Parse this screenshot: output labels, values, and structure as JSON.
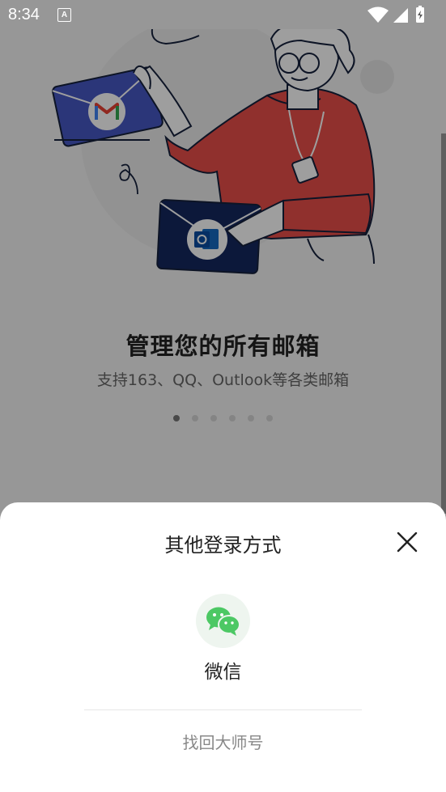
{
  "status_bar": {
    "time": "8:34",
    "notification_glyph": "A",
    "icons": [
      "wifi-icon",
      "cellular-signal-icon",
      "battery-charging-icon"
    ]
  },
  "onboarding": {
    "title": "管理您的所有邮箱",
    "subtitle": "支持163、QQ、Outlook等各类邮箱",
    "page_count": 6,
    "active_page": 1,
    "illustration_icons": [
      "gmail-icon",
      "outlook-icon"
    ]
  },
  "login_sheet": {
    "title": "其他登录方式",
    "options": [
      {
        "label": "微信",
        "icon": "wechat-icon"
      }
    ],
    "recover_account": "找回大师号"
  },
  "colors": {
    "wechat_green": "#4cc864",
    "sweater_red": "#e84e49",
    "envelope_blue": "#4657c4",
    "envelope_navy": "#14275e"
  }
}
